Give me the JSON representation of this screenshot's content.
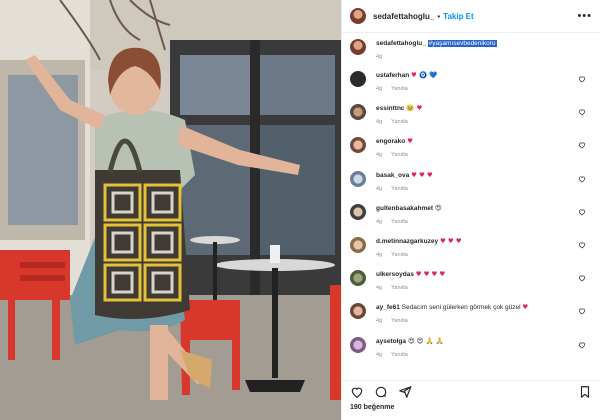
{
  "post": {
    "username": "sedafettahoglu_",
    "separator": "•",
    "follow_label": "Takip Et",
    "more_label": "•••",
    "caption": {
      "username": "sedafettahoglu_",
      "hashtag": "#yaşamısevbedenikoru",
      "time": "4g"
    },
    "likes_label": "190 beğenme"
  },
  "comments": [
    {
      "username": "ustaferhan",
      "text": "",
      "emojis": "♥ 🧿 💙",
      "time": "4g",
      "reply": "Yanıtla"
    },
    {
      "username": "essinttnc",
      "text": "",
      "emojis": "🥹 ♥",
      "time": "4g",
      "reply": "Yanıtla"
    },
    {
      "username": "engorako",
      "text": "",
      "emojis": "♥",
      "time": "4g",
      "reply": "Yanıtla"
    },
    {
      "username": "basak_ova",
      "text": "",
      "emojis": "♥ ♥ ♥",
      "time": "4g",
      "reply": "Yanıtla"
    },
    {
      "username": "gultenbasakahmet",
      "text": "",
      "emojis": "😍",
      "time": "4g",
      "reply": "Yanıtla"
    },
    {
      "username": "d.metinnazgarkuzey",
      "text": "",
      "emojis": "♥ ♥ ♥",
      "time": "4g",
      "reply": "Yanıtla"
    },
    {
      "username": "ulkersoydas",
      "text": "",
      "emojis": "♥ ♥ ♥ ♥",
      "time": "4g",
      "reply": "Yanıtla"
    },
    {
      "username": "ay_fe61",
      "text": "Sedacım seni gülerken görmek çok güzel",
      "emojis": "♥",
      "time": "4g",
      "reply": "Yanıtla"
    },
    {
      "username": "aysetolga",
      "text": "",
      "emojis": "😍 😍 🙏 🙏",
      "time": "4g",
      "reply": "Yanıtla"
    }
  ],
  "colors": {
    "accent": "#0095f6",
    "heart": "#e0245e",
    "hashtag_highlight": "#2b63c9"
  },
  "icons": {
    "like": "heart-icon",
    "comment": "comment-icon",
    "share": "share-icon",
    "save": "bookmark-icon"
  }
}
